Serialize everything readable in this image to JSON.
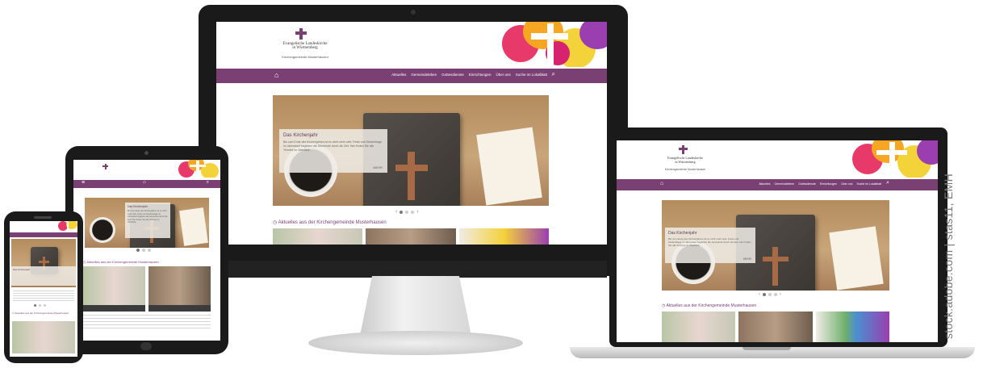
{
  "site": {
    "church_name_line1": "Evangelische Landeskirche",
    "church_name_line2": "in Württemberg",
    "parish": "Kirchengemeinde Musterhausen",
    "home_icon": "home-icon",
    "search_icon": "search-icon",
    "menu_icon": "menu-icon",
    "nav": [
      "Aktuelles",
      "Gemeindeleben",
      "Gottesdienste",
      "Einrichtungen",
      "Über uns",
      "Suche im Lokalblatt"
    ]
  },
  "hero": {
    "title": "Das Kirchenjahr",
    "text": "Bis zum Ende des Kirchenjahres ist es nicht mehr weit. Feste und Gedenktage im Jahreslauf begleiten die Gemeinde durch die Zeit. Hier finden Sie alle Termine im Überblick.",
    "more": "MEHR",
    "slide_prev": "‹",
    "slide_next": "›"
  },
  "news": {
    "title": "Aktuelles aus der Kirchengemeinde Musterhausen"
  },
  "credit": "stock.adobe.com | stas11, EMH",
  "colors": {
    "brand": "#7a3f73"
  }
}
